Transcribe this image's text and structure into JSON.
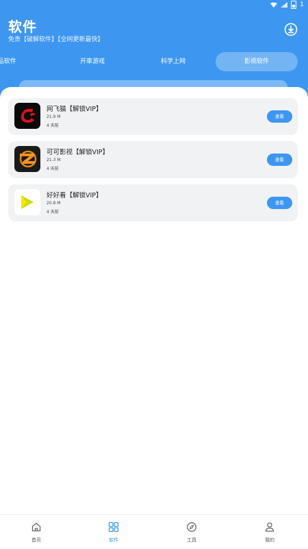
{
  "status_bar": {
    "battery": "1"
  },
  "header": {
    "title": "软件",
    "subtitle": "免责【破解软件】【全网更新最快】"
  },
  "tabs": [
    {
      "label": "品软件"
    },
    {
      "label": "开車游戏"
    },
    {
      "label": "科学上网"
    },
    {
      "label": "影视软件",
      "active": true
    }
  ],
  "apps": [
    {
      "name": "网飞猫【解锁VIP】",
      "size": "21.9 M",
      "date": "4 天前",
      "button": "查看",
      "icon": "netflix-cat-icon"
    },
    {
      "name": "可可影视【解锁VIP】",
      "size": "21.3 M",
      "date": "4 天前",
      "button": "查看",
      "icon": "keke-video-icon"
    },
    {
      "name": "好好看【解锁VIP】",
      "size": "20.8 M",
      "date": "4 天前",
      "button": "查看",
      "icon": "haohaokan-icon"
    }
  ],
  "bottom_nav": [
    {
      "label": "首页",
      "icon": "home-icon"
    },
    {
      "label": "软件",
      "icon": "grid-icon",
      "active": true
    },
    {
      "label": "工具",
      "icon": "compass-icon"
    },
    {
      "label": "我的",
      "icon": "user-icon"
    }
  ],
  "colors": {
    "accent": "#3d97f0",
    "card": "#f1f2f4"
  }
}
